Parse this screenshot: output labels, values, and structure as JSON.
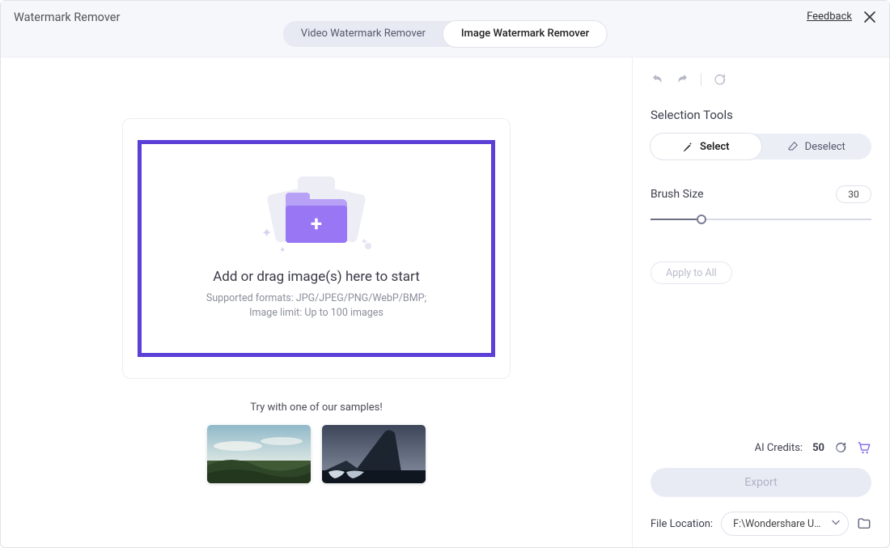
{
  "header": {
    "title": "Watermark Remover",
    "feedback": "Feedback",
    "tabs": {
      "video": "Video Watermark Remover",
      "image": "Image Watermark Remover"
    }
  },
  "drop": {
    "heading": "Add or drag image(s) here to start",
    "formats": "Supported formats: JPG/JPEG/PNG/WebP/BMP;",
    "limit": "Image limit: Up to 100 images"
  },
  "samples": {
    "label": "Try with one of our samples!"
  },
  "panel": {
    "selection_title": "Selection Tools",
    "select": "Select",
    "deselect": "Deselect",
    "brush_label": "Brush Size",
    "brush_value": "30",
    "apply_all": "Apply to All"
  },
  "credits": {
    "label": "AI Credits:",
    "value": "50"
  },
  "export": {
    "label": "Export"
  },
  "fileloc": {
    "label": "File Location:",
    "path": "F:\\Wondershare UniCon"
  }
}
